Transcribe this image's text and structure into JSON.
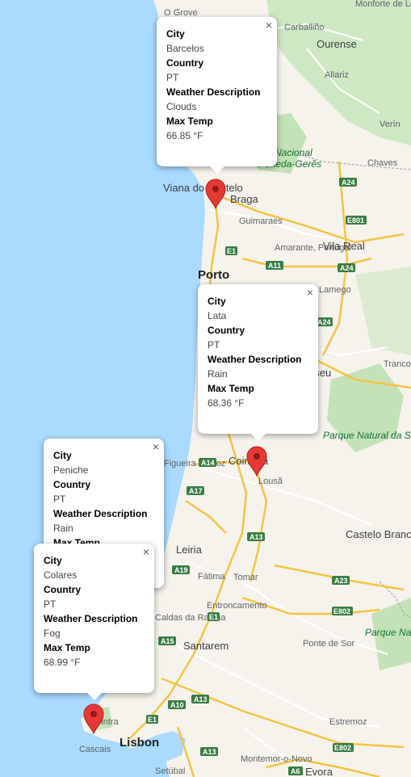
{
  "map": {
    "labels": {
      "o_grove": "O Grove",
      "carballino": "Carballiño",
      "ourense": "Ourense",
      "monforte": "Monforte de Lemos",
      "allariz": "Allariz",
      "verin": "Verín",
      "chaves": "Chaves",
      "nacional": "Nacional",
      "peneda": "Peneda-Gerês",
      "viana": "Viana do Castelo",
      "braga": "Braga",
      "guimaraes": "Guimaraes",
      "amarante": "Amarante, Portugal",
      "vila_real": "Vila Real",
      "porto": "Porto",
      "lamego": "Lamego",
      "viseu": "Viseu",
      "trancoso": "Trancoso",
      "parque_estrela": "Parque Natural da Serra da Estrela",
      "figueira": "Figueira da Foz",
      "coimbra": "Coimbra",
      "lousa": "Lousã",
      "castelo_branco": "Castelo Branco",
      "leiria": "Leiria",
      "fatima": "Fátima",
      "tomar": "Tomar",
      "caldas": "Caldas da Rainha",
      "entroncamento": "Entroncamento",
      "santarem": "Santarem",
      "ponte_sor": "Ponte de Sor",
      "parque_sao_mamede": "Parque Natural da Serra de S. Mamede",
      "sintra": "Sintra",
      "lisbon": "Lisbon",
      "cascais": "Cascais",
      "estremoz": "Estremoz",
      "montemor": "Montemor-o-Novo",
      "evora": "Evora",
      "setubal": "Setúbal"
    },
    "shields": {
      "a24_1": "A24",
      "e801": "E801",
      "e1_1": "E1",
      "a11": "A11",
      "a24_2": "A24",
      "a24_3": "A24",
      "a14": "A14",
      "a17": "A17",
      "a13_1": "A13",
      "a19": "A19",
      "a23": "A23",
      "e1_2": "E1",
      "e802_1": "E802",
      "a15": "A15",
      "a13_2": "A13",
      "a10": "A10",
      "e1_3": "E1",
      "a13_3": "A13",
      "e802_2": "E802",
      "a6": "A6"
    }
  },
  "infowindows": [
    {
      "labels": {
        "city": "City",
        "country": "Country",
        "weather": "Weather Description",
        "max_temp": "Max Temp"
      },
      "city": "Barcelos",
      "country": "PT",
      "weather": "Clouds",
      "max_temp": "66.85 °F"
    },
    {
      "labels": {
        "city": "City",
        "country": "Country",
        "weather": "Weather Description",
        "max_temp": "Max Temp"
      },
      "city": "Lata",
      "country": "PT",
      "weather": "Rain",
      "max_temp": "68.36 °F"
    },
    {
      "labels": {
        "city": "City",
        "country": "Country",
        "weather": "Weather Description",
        "max_temp": "Max Temp"
      },
      "city": "Peniche",
      "country": "PT",
      "weather": "Rain",
      "max_temp": ""
    },
    {
      "labels": {
        "city": "City",
        "country": "Country",
        "weather": "Weather Description",
        "max_temp": "Max Temp"
      },
      "city": "Colares",
      "country": "PT",
      "weather": "Fog",
      "max_temp": "68.99 °F"
    }
  ],
  "close_glyph": "×",
  "colors": {
    "water": "#aadaff",
    "land": "#f8f6ee",
    "park": "#c8e6c0",
    "motorway": "#f6c342",
    "marker": "#e53935"
  }
}
